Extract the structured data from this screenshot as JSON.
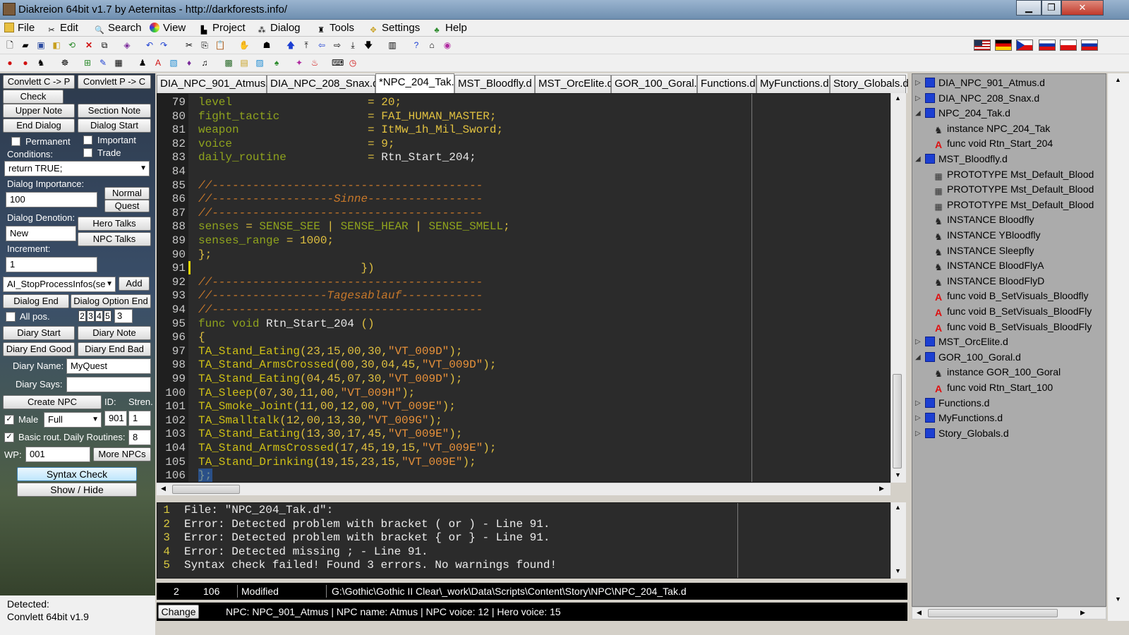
{
  "window": {
    "title": "Diakreion 64bit v1.7 by Aeternitas - http://darkforests.info/",
    "minimize": "▁",
    "maximize": "❐",
    "close": "✕"
  },
  "menu": [
    {
      "label": "File",
      "icon": "folder-icon"
    },
    {
      "label": "Edit",
      "icon": "tools-icon"
    },
    {
      "label": "Search",
      "icon": "search-icon"
    },
    {
      "label": "View",
      "icon": "palette-icon"
    },
    {
      "label": "Project",
      "icon": "project-icon"
    },
    {
      "label": "Dialog",
      "icon": "dialog-icon"
    },
    {
      "label": "Tools",
      "icon": "potion-icon"
    },
    {
      "label": "Settings",
      "icon": "settings-icon"
    },
    {
      "label": "Help",
      "icon": "help-icon"
    }
  ],
  "left": {
    "convlett_cp": "Convlett C -> P",
    "convlett_pc": "Convlett P -> C",
    "check": "Check",
    "upper_note": "Upper Note",
    "section_note": "Section Note",
    "end_dialog": "End Dialog",
    "dialog_start": "Dialog Start",
    "permanent": "Permanent",
    "important": "Important",
    "trade": "Trade",
    "conditions_label": "Conditions:",
    "conditions_value": "return TRUE;",
    "importance_label": "Dialog Importance:",
    "importance_value": "100",
    "normal": "Normal",
    "quest": "Quest",
    "denotion_label": "Dialog Denotion:",
    "denotion_value": "New",
    "hero_talks": "Hero Talks",
    "npc_talks": "NPC Talks",
    "increment_label": "Increment:",
    "increment_value": "1",
    "ai_select": "AI_StopProcessInfos(se",
    "add": "Add",
    "dialog_end": "Dialog End",
    "dialog_option_end": "Dialog Option End",
    "all_pos": "All pos.",
    "pos_numbers": [
      "2",
      "3",
      "4",
      "5"
    ],
    "pos_value": "3",
    "diary_start": "Diary Start",
    "diary_note": "Diary Note",
    "diary_end_good": "Diary End Good",
    "diary_end_bad": "Diary End Bad",
    "diary_name_label": "Diary Name:",
    "diary_name_value": "MyQuest",
    "diary_says_label": "Diary Says:",
    "diary_says_value": "",
    "create_npc": "Create NPC",
    "id_label": "ID:",
    "stren_label": "Stren.",
    "male": "Male",
    "body_select": "Full",
    "id_value": "901",
    "stren_value": "1",
    "basic_rout": "Basic rout.",
    "daily_routines_label": "Daily Routines:",
    "daily_routines_value": "8",
    "wp_label": "WP:",
    "wp_value": "001",
    "more_npcs": "More NPCs",
    "syntax_check": "Syntax Check",
    "show_hide": "Show / Hide",
    "detected_label": "Detected:",
    "detected_value": "Convlett 64bit v1.9"
  },
  "tabs": [
    {
      "label": "DIA_NPC_901_Atmus.d",
      "active": false
    },
    {
      "label": "DIA_NPC_208_Snax.d",
      "active": false
    },
    {
      "label": "*NPC_204_Tak.d",
      "active": true
    },
    {
      "label": "MST_Bloodfly.d",
      "active": false
    },
    {
      "label": "MST_OrcElite.d",
      "active": false
    },
    {
      "label": "GOR_100_Goral.d",
      "active": false
    },
    {
      "label": "Functions.d",
      "active": false
    },
    {
      "label": "MyFunctions.d",
      "active": false
    },
    {
      "label": "Story_Globals.d",
      "active": false
    }
  ],
  "editor": {
    "lines": [
      {
        "n": "79",
        "t": [
          [
            "k",
            "level"
          ],
          [
            "w",
            "                    "
          ],
          [
            "o",
            "= "
          ],
          [
            "o",
            "20"
          ],
          [
            "o",
            ";"
          ]
        ]
      },
      {
        "n": "80",
        "t": [
          [
            "k",
            "fight_tactic"
          ],
          [
            "w",
            "             "
          ],
          [
            "o",
            "= "
          ],
          [
            "o",
            "FAI_HUMAN_MASTER;"
          ]
        ]
      },
      {
        "n": "81",
        "t": [
          [
            "k",
            "weapon"
          ],
          [
            "w",
            "                   "
          ],
          [
            "o",
            "= "
          ],
          [
            "o",
            "ItMw_1h_Mil_Sword;"
          ]
        ]
      },
      {
        "n": "82",
        "t": [
          [
            "k",
            "voice"
          ],
          [
            "w",
            "                    "
          ],
          [
            "o",
            "= "
          ],
          [
            "o",
            "9;"
          ]
        ]
      },
      {
        "n": "83",
        "t": [
          [
            "k",
            "daily_routine"
          ],
          [
            "w",
            "            "
          ],
          [
            "o",
            "= "
          ],
          [
            "w",
            "Rtn_Start_204;"
          ]
        ]
      },
      {
        "n": "84",
        "t": [
          [
            "w",
            ""
          ]
        ]
      },
      {
        "n": "85",
        "t": [
          [
            "cm",
            "//----------------------------------------"
          ]
        ]
      },
      {
        "n": "86",
        "t": [
          [
            "cm",
            "//------------------Sinne-----------------"
          ]
        ]
      },
      {
        "n": "87",
        "t": [
          [
            "cm",
            "//----------------------------------------"
          ]
        ]
      },
      {
        "n": "88",
        "t": [
          [
            "k",
            "senses "
          ],
          [
            "o",
            "= "
          ],
          [
            "k",
            "SENSE_SEE "
          ],
          [
            "o",
            "| "
          ],
          [
            "k",
            "SENSE_HEAR "
          ],
          [
            "o",
            "| "
          ],
          [
            "k",
            "SENSE_SMELL"
          ],
          [
            "o",
            ";"
          ]
        ]
      },
      {
        "n": "89",
        "t": [
          [
            "k",
            "senses_range "
          ],
          [
            "o",
            "= "
          ],
          [
            "o",
            "1000;"
          ]
        ]
      },
      {
        "n": "90",
        "t": [
          [
            "o",
            "};"
          ]
        ]
      },
      {
        "n": "91",
        "t": [
          [
            "w",
            "                        "
          ],
          [
            "o",
            "})"
          ]
        ]
      },
      {
        "n": "92",
        "t": [
          [
            "cm",
            "//----------------------------------------"
          ]
        ]
      },
      {
        "n": "93",
        "t": [
          [
            "cm",
            "//-----------------Tagesablauf------------"
          ]
        ]
      },
      {
        "n": "94",
        "t": [
          [
            "cm",
            "//----------------------------------------"
          ]
        ]
      },
      {
        "n": "95",
        "t": [
          [
            "k",
            "func "
          ],
          [
            "k",
            "void "
          ],
          [
            "w",
            "Rtn_Start_204 "
          ],
          [
            "o",
            "()"
          ]
        ]
      },
      {
        "n": "96",
        "t": [
          [
            "o",
            "{"
          ]
        ]
      },
      {
        "n": "97",
        "t": [
          [
            "fn",
            "TA_Stand_Eating"
          ],
          [
            "o",
            "(23,15,00,30,"
          ],
          [
            "s",
            "\"VT_009D\""
          ],
          [
            "o",
            ");"
          ]
        ]
      },
      {
        "n": "98",
        "t": [
          [
            "fn",
            "TA_Stand_ArmsCrossed"
          ],
          [
            "o",
            "(00,30,04,45,"
          ],
          [
            "s",
            "\"VT_009D\""
          ],
          [
            "o",
            ");"
          ]
        ]
      },
      {
        "n": "99",
        "t": [
          [
            "fn",
            "TA_Stand_Eating"
          ],
          [
            "o",
            "(04,45,07,30,"
          ],
          [
            "s",
            "\"VT_009D\""
          ],
          [
            "o",
            ");"
          ]
        ]
      },
      {
        "n": "100",
        "t": [
          [
            "fn",
            "TA_Sleep"
          ],
          [
            "o",
            "(07,30,11,00,"
          ],
          [
            "s",
            "\"VT_009H\""
          ],
          [
            "o",
            ");"
          ]
        ]
      },
      {
        "n": "101",
        "t": [
          [
            "fn",
            "TA_Smoke_Joint"
          ],
          [
            "o",
            "(11,00,12,00,"
          ],
          [
            "s",
            "\"VT_009E\""
          ],
          [
            "o",
            ");"
          ]
        ]
      },
      {
        "n": "102",
        "t": [
          [
            "fn",
            "TA_Smalltalk"
          ],
          [
            "o",
            "(12,00,13,30,"
          ],
          [
            "s",
            "\"VT_009G\""
          ],
          [
            "o",
            ");"
          ]
        ]
      },
      {
        "n": "103",
        "t": [
          [
            "fn",
            "TA_Stand_Eating"
          ],
          [
            "o",
            "(13,30,17,45,"
          ],
          [
            "s",
            "\"VT_009E\""
          ],
          [
            "o",
            ");"
          ]
        ]
      },
      {
        "n": "104",
        "t": [
          [
            "fn",
            "TA_Stand_ArmsCrossed"
          ],
          [
            "o",
            "(17,45,19,15,"
          ],
          [
            "s",
            "\"VT_009E\""
          ],
          [
            "o",
            ");"
          ]
        ]
      },
      {
        "n": "105",
        "t": [
          [
            "fn",
            "TA_Stand_Drinking"
          ],
          [
            "o",
            "(19,15,23,15,"
          ],
          [
            "s",
            "\"VT_009E\""
          ],
          [
            "o",
            ");"
          ]
        ]
      },
      {
        "n": "106",
        "t": [
          [
            "o",
            "};"
          ]
        ]
      }
    ]
  },
  "output": {
    "lines": [
      {
        "n": "1",
        "text": "File: \"NPC_204_Tak.d\":"
      },
      {
        "n": "2",
        "text": "Error: Detected problem with bracket ( or ) - Line 91."
      },
      {
        "n": "3",
        "text": "Error: Detected problem with bracket { or } - Line 91."
      },
      {
        "n": "4",
        "text": "Error: Detected missing ; - Line 91."
      },
      {
        "n": "5",
        "text": "Syntax check failed! Found 3 errors. No warnings found!"
      }
    ]
  },
  "status": {
    "col": "2",
    "line": "106",
    "state": "Modified",
    "path": "G:\\Gothic\\Gothic II Clear\\_work\\Data\\Scripts\\Content\\Story\\NPC\\NPC_204_Tak.d",
    "change": "Change",
    "npc_info": "NPC: NPC_901_Atmus  |  NPC name: Atmus  |  NPC voice: 12  |  Hero voice: 15"
  },
  "tree": [
    {
      "label": "DIA_NPC_901_Atmus.d",
      "type": "file",
      "level": 0,
      "exp": "▷"
    },
    {
      "label": "DIA_NPC_208_Snax.d",
      "type": "file",
      "level": 0,
      "exp": "▷"
    },
    {
      "label": "NPC_204_Tak.d",
      "type": "file",
      "level": 0,
      "exp": "◢"
    },
    {
      "label": "instance NPC_204_Tak",
      "type": "inst",
      "level": 1
    },
    {
      "label": "func void Rtn_Start_204",
      "type": "func",
      "level": 1
    },
    {
      "label": "MST_Bloodfly.d",
      "type": "file",
      "level": 0,
      "exp": "◢"
    },
    {
      "label": "PROTOTYPE Mst_Default_Blood",
      "type": "proto",
      "level": 1
    },
    {
      "label": "PROTOTYPE Mst_Default_Blood",
      "type": "proto",
      "level": 1
    },
    {
      "label": "PROTOTYPE Mst_Default_Blood",
      "type": "proto",
      "level": 1
    },
    {
      "label": "INSTANCE Bloodfly",
      "type": "inst",
      "level": 1
    },
    {
      "label": "INSTANCE YBloodfly",
      "type": "inst",
      "level": 1
    },
    {
      "label": "INSTANCE Sleepfly",
      "type": "inst",
      "level": 1
    },
    {
      "label": "INSTANCE BloodFlyA",
      "type": "inst",
      "level": 1
    },
    {
      "label": "INSTANCE BloodFlyD",
      "type": "inst",
      "level": 1
    },
    {
      "label": "func void B_SetVisuals_Bloodfly",
      "type": "func",
      "level": 1
    },
    {
      "label": "func void B_SetVisuals_BloodFly",
      "type": "func",
      "level": 1
    },
    {
      "label": "func void B_SetVisuals_BloodFly",
      "type": "func",
      "level": 1
    },
    {
      "label": "MST_OrcElite.d",
      "type": "file",
      "level": 0,
      "exp": "▷"
    },
    {
      "label": "GOR_100_Goral.d",
      "type": "file",
      "level": 0,
      "exp": "◢"
    },
    {
      "label": "instance GOR_100_Goral",
      "type": "inst",
      "level": 1
    },
    {
      "label": "func void Rtn_Start_100",
      "type": "func",
      "level": 1
    },
    {
      "label": "Functions.d",
      "type": "file",
      "level": 0,
      "exp": "▷"
    },
    {
      "label": "MyFunctions.d",
      "type": "file",
      "level": 0,
      "exp": "▷"
    },
    {
      "label": "Story_Globals.d",
      "type": "file",
      "level": 0,
      "exp": "▷"
    }
  ],
  "colors": {
    "editor_bg": "#2b2b2b",
    "keyword": "#8fa31d",
    "operator": "#e0c040",
    "comment": "#c8782a",
    "string": "#e8913a",
    "accent": "#1c3fd2"
  }
}
